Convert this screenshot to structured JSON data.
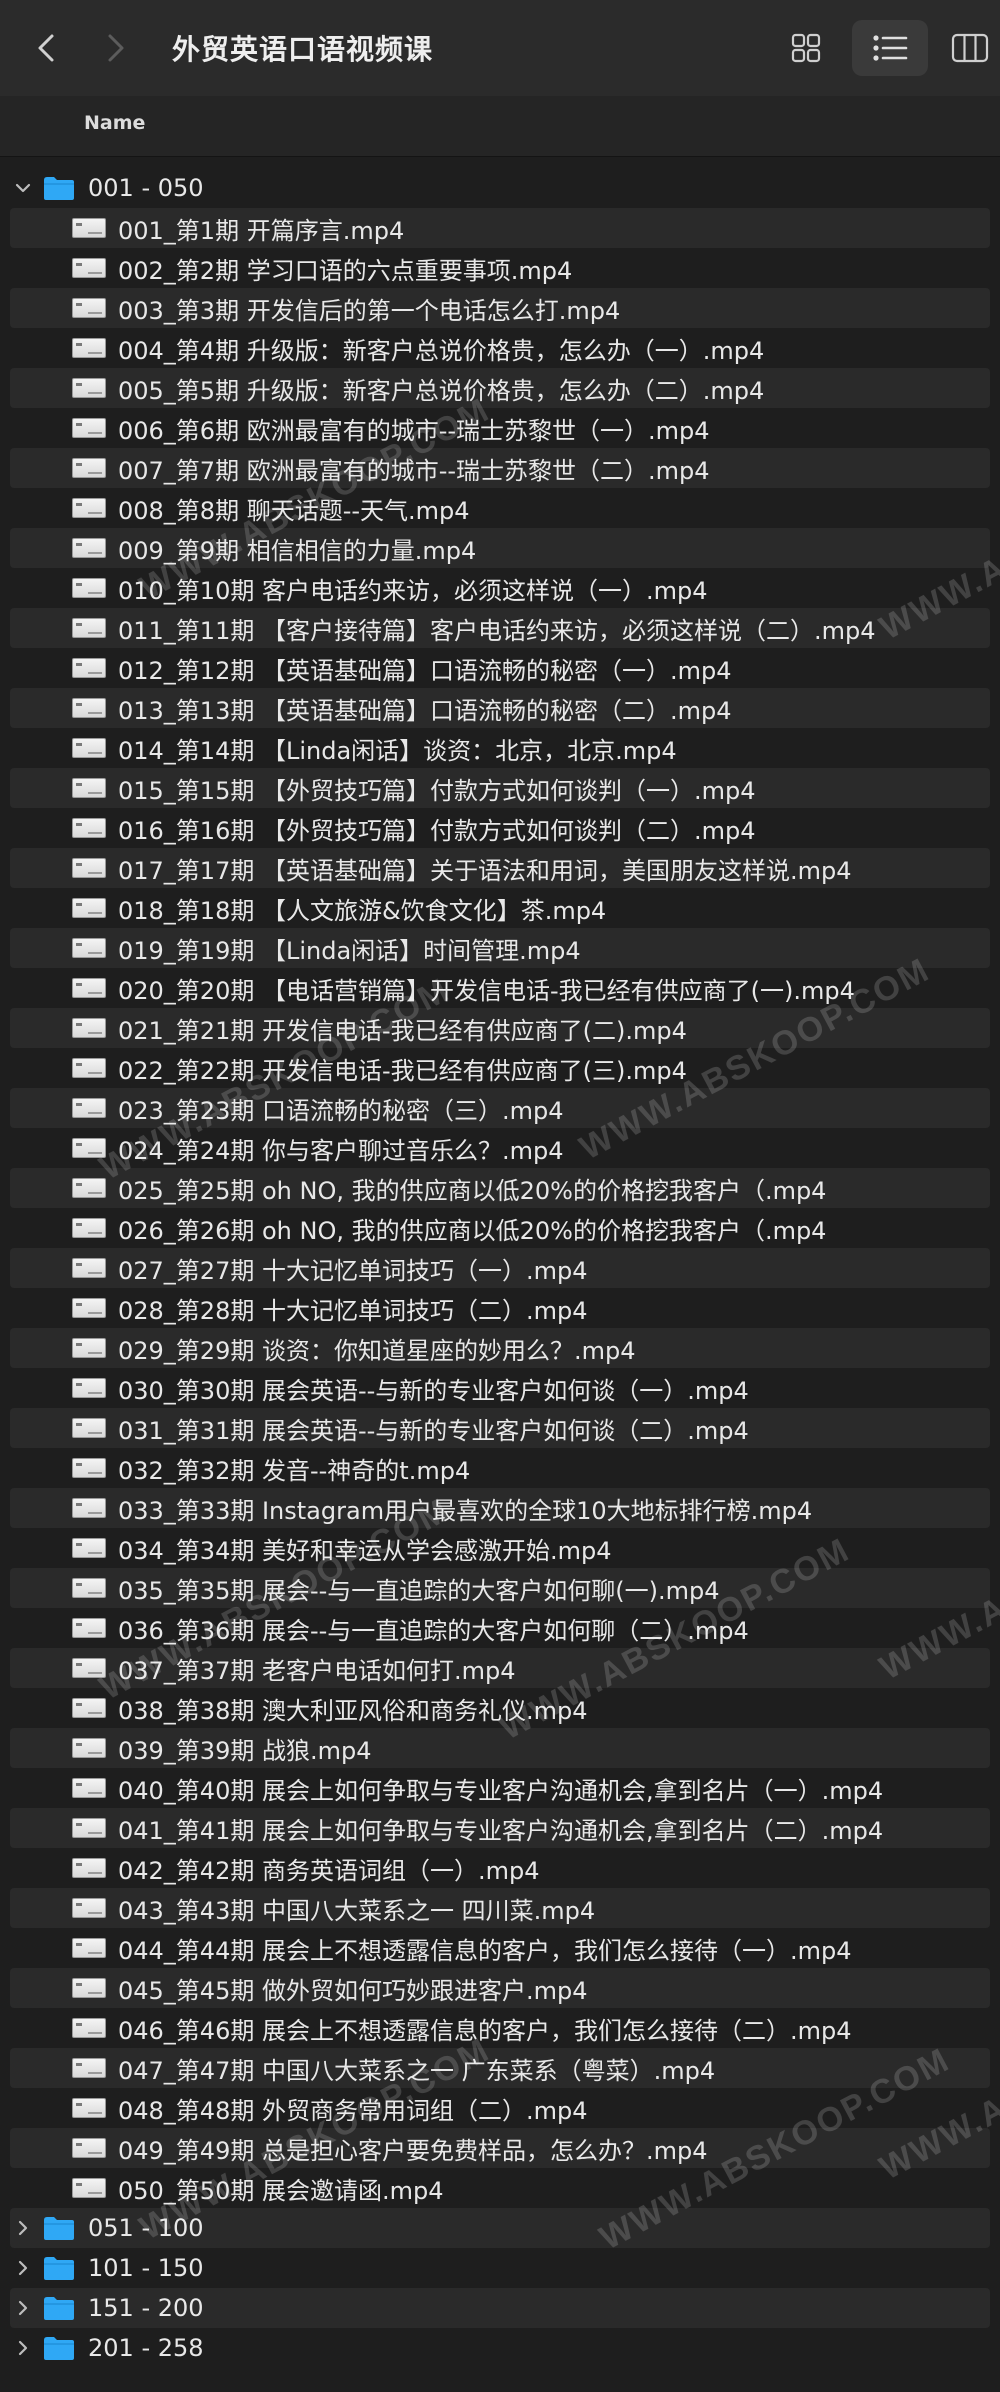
{
  "window": {
    "title": "外贸英语口语视频课"
  },
  "header": {
    "name_label": "Name"
  },
  "open_folder": {
    "name": "001 - 050",
    "files": [
      "001_第1期 开篇序言.mp4",
      "002_第2期 学习口语的六点重要事项.mp4",
      "003_第3期 开发信后的第一个电话怎么打.mp4",
      "004_第4期 升级版：新客户总说价格贵，怎么办（一）.mp4",
      "005_第5期 升级版：新客户总说价格贵，怎么办（二）.mp4",
      "006_第6期 欧洲最富有的城市--瑞士苏黎世（一）.mp4",
      "007_第7期 欧洲最富有的城市--瑞士苏黎世（二）.mp4",
      "008_第8期 聊天话题--天气.mp4",
      "009_第9期 相信相信的力量.mp4",
      "010_第10期 客户电话约来访，必须这样说（一）.mp4",
      "011_第11期 【客户接待篇】客户电话约来访，必须这样说（二）.mp4",
      "012_第12期 【英语基础篇】口语流畅的秘密（一）.mp4",
      "013_第13期 【英语基础篇】口语流畅的秘密（二）.mp4",
      "014_第14期 【Linda闲话】谈资：北京，北京.mp4",
      "015_第15期 【外贸技巧篇】付款方式如何谈判（一）.mp4",
      "016_第16期 【外贸技巧篇】付款方式如何谈判（二）.mp4",
      "017_第17期 【英语基础篇】关于语法和用词，美国朋友这样说.mp4",
      "018_第18期 【人文旅游&饮食文化】茶.mp4",
      "019_第19期 【Linda闲话】时间管理.mp4",
      "020_第20期 【电话营销篇】开发信电话-我已经有供应商了(一).mp4",
      "021_第21期 开发信电话-我已经有供应商了(二).mp4",
      "022_第22期 开发信电话-我已经有供应商了(三).mp4",
      "023_第23期 口语流畅的秘密（三）.mp4",
      "024_第24期 你与客户聊过音乐么？.mp4",
      "025_第25期 oh NO, 我的供应商以低20%的价格挖我客户（.mp4",
      "026_第26期 oh NO, 我的供应商以低20%的价格挖我客户（.mp4",
      "027_第27期 十大记忆单词技巧（一）.mp4",
      "028_第28期 十大记忆单词技巧（二）.mp4",
      "029_第29期 谈资：你知道星座的妙用么？.mp4",
      "030_第30期 展会英语--与新的专业客户如何谈（一）.mp4",
      "031_第31期 展会英语--与新的专业客户如何谈（二）.mp4",
      "032_第32期 发音--神奇的t.mp4",
      "033_第33期 Instagram用户最喜欢的全球10大地标排行榜.mp4",
      "034_第34期 美好和幸运从学会感激开始.mp4",
      "035_第35期 展会--与一直追踪的大客户如何聊(一).mp4",
      "036_第36期 展会--与一直追踪的大客户如何聊（二）.mp4",
      "037_第37期 老客户电话如何打.mp4",
      "038_第38期 澳大利亚风俗和商务礼仪.mp4",
      "039_第39期 战狼.mp4",
      "040_第40期 展会上如何争取与专业客户沟通机会,拿到名片（一）.mp4",
      "041_第41期 展会上如何争取与专业客户沟通机会,拿到名片（二）.mp4",
      "042_第42期 商务英语词组（一）.mp4",
      "043_第43期 中国八大菜系之一 四川菜.mp4",
      "044_第44期 展会上不想透露信息的客户，我们怎么接待（一）.mp4",
      "045_第45期 做外贸如何巧妙跟进客户.mp4",
      "046_第46期 展会上不想透露信息的客户，我们怎么接待（二）.mp4",
      "047_第47期 中国八大菜系之一 广东菜系（粤菜）.mp4",
      "048_第48期 外贸商务常用词组（二）.mp4",
      "049_第49期 总是担心客户要免费样品，怎么办？.mp4",
      "050_第50期 展会邀请函.mp4"
    ]
  },
  "closed_folders": [
    "051 - 100",
    "101 - 150",
    "151 - 200",
    "201 - 258"
  ],
  "watermark_text": "WWW.ABSKOOP.COM",
  "colors": {
    "folder": "#2fa8f5",
    "background": "#1e1e1e",
    "stripe": "#2a2a2a"
  },
  "icons": {
    "back": "chevron-left-icon",
    "forward": "chevron-right-icon",
    "grid": "grid-view-icon",
    "list": "list-view-icon",
    "columns": "column-view-icon"
  }
}
